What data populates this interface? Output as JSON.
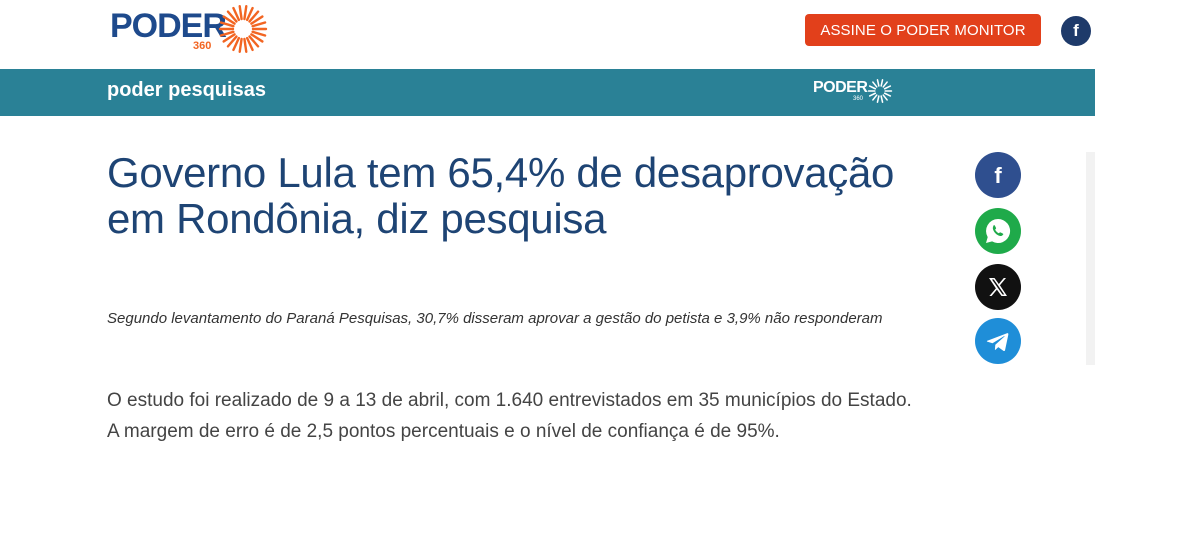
{
  "header": {
    "logo_word": "PODER",
    "logo_number": "360",
    "subscribe_label": "ASSINE O PODER MONITOR",
    "facebook_glyph": "f",
    "colors": {
      "brand_blue": "#1e4a8c",
      "brand_orange": "#f26522",
      "subscribe_bg": "#e2401b"
    }
  },
  "section_bar": {
    "title": "poder pesquisas",
    "mini_logo_word": "PODER",
    "mini_logo_number": "360",
    "color": "#2a8196"
  },
  "article": {
    "headline": "Governo Lula tem 65,4% de desaprovação em Rondônia, diz pesquisa",
    "subtitle": "Segundo levantamento do Paraná Pesquisas, 30,7% disseram aprovar a gestão do petista e 3,9% não responderam",
    "body": "O estudo foi realizado de 9 a 13 de abril, com 1.640 entrevistados em 35 municípios do Estado. A margem de erro é de 2,5 pontos percentuais e o nível de confiança é de 95%."
  },
  "share": {
    "icons": [
      "facebook-icon",
      "whatsapp-icon",
      "x-icon",
      "telegram-icon"
    ],
    "facebook_glyph": "f",
    "colors": {
      "facebook": "#2f4f8f",
      "whatsapp": "#1faa4a",
      "x": "#111111",
      "telegram": "#1f8ed8"
    }
  }
}
